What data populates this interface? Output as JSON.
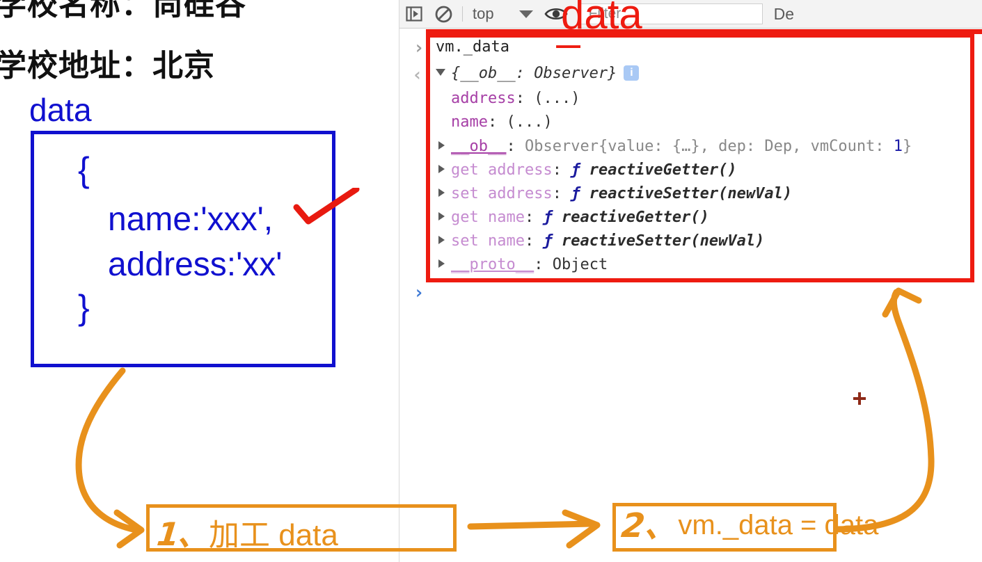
{
  "slide": {
    "school_name_line": "学校名称：尚硅谷",
    "school_address_line": "学校地址：北京",
    "data_label": "data",
    "code": {
      "open_brace": "{",
      "name_line": "name:'xxx',",
      "address_line": "address:'xx'",
      "close_brace": "}"
    },
    "check_icon": "red-check-mark"
  },
  "annotations": {
    "step1_number": "1、",
    "step1_text": "加工 data",
    "step2_number": "2、",
    "step2_text": "vm._data = data",
    "console_label_underscore": "_",
    "console_label_text": "data",
    "arrow_middle": "arrow-right",
    "arrow_left_curve": "curved-arrow-to-step1",
    "arrow_right_curve": "curved-arrow-to-console"
  },
  "devtools": {
    "toolbar": {
      "sidebar_icon": "console-sidebar-icon",
      "clear_icon": "clear-console-icon",
      "context_value": "top",
      "context_caret": "chevron-down-icon",
      "eye_icon": "live-expression-eye-icon",
      "filter_placeholder": "Filter",
      "filter_value": "",
      "levels_label": "De"
    },
    "console": {
      "input_prompt": "›",
      "output_prompt": "‹",
      "blank_prompt": "›",
      "input_expression": "vm._data",
      "result_header": "{__ob__: Observer}",
      "info_badge": "i",
      "rows": [
        {
          "kind": "prop",
          "key": "address",
          "value": "(...)"
        },
        {
          "kind": "prop",
          "key": "name",
          "value": "(...)"
        },
        {
          "kind": "internal",
          "key": "__ob__",
          "value": "Observer {value: {…}, dep: Dep, vmCount: 1}",
          "value_parts": {
            "ctor": "Observer",
            "open": "{value: {…}, dep: Dep, vmCount: ",
            "count": "1",
            "close": "}"
          }
        },
        {
          "kind": "accessor",
          "prefix": "get",
          "key": "address",
          "fn": "reactiveGetter()"
        },
        {
          "kind": "accessor",
          "prefix": "set",
          "key": "address",
          "fn": "reactiveSetter(newVal)"
        },
        {
          "kind": "accessor",
          "prefix": "get",
          "key": "name",
          "fn": "reactiveGetter()"
        },
        {
          "kind": "accessor",
          "prefix": "set",
          "key": "name",
          "fn": "reactiveSetter(newVal)"
        },
        {
          "kind": "proto",
          "key": "__proto__",
          "value": "Object"
        }
      ]
    }
  },
  "colors": {
    "red_annotation": "#ee1b10",
    "orange_annotation": "#e8911c",
    "blue_slide": "#1010cf",
    "console_property": "#a63fa6",
    "console_accessor": "#c58bd0",
    "console_number": "#1a1aa6"
  }
}
